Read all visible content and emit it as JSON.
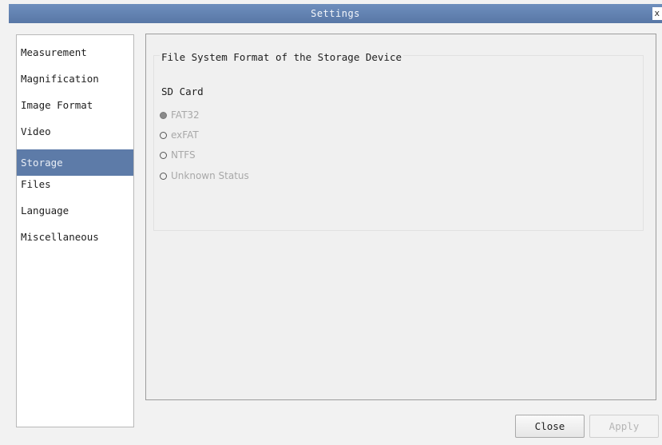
{
  "window": {
    "title": "Settings",
    "close_glyph": "x"
  },
  "sidebar": {
    "items": [
      {
        "label": "Measurement"
      },
      {
        "label": "Magnification"
      },
      {
        "label": "Image Format"
      },
      {
        "label": "Video"
      },
      {
        "label": "Storage"
      },
      {
        "label": "Files"
      },
      {
        "label": "Language"
      },
      {
        "label": "Miscellaneous"
      }
    ],
    "selected": "Storage"
  },
  "storage": {
    "group_title": "File System Format of the Storage Device",
    "device_label": "SD Card",
    "options": [
      {
        "label": "FAT32",
        "checked": true
      },
      {
        "label": "exFAT",
        "checked": false
      },
      {
        "label": "NTFS",
        "checked": false
      },
      {
        "label": "Unknown Status",
        "checked": false
      }
    ]
  },
  "buttons": {
    "close_label": "Close",
    "apply_label": "Apply"
  },
  "colors": {
    "titlebar": "#5d7ba8",
    "selected_item": "#5d7ba8",
    "disabled_text": "#a8a8a8"
  }
}
